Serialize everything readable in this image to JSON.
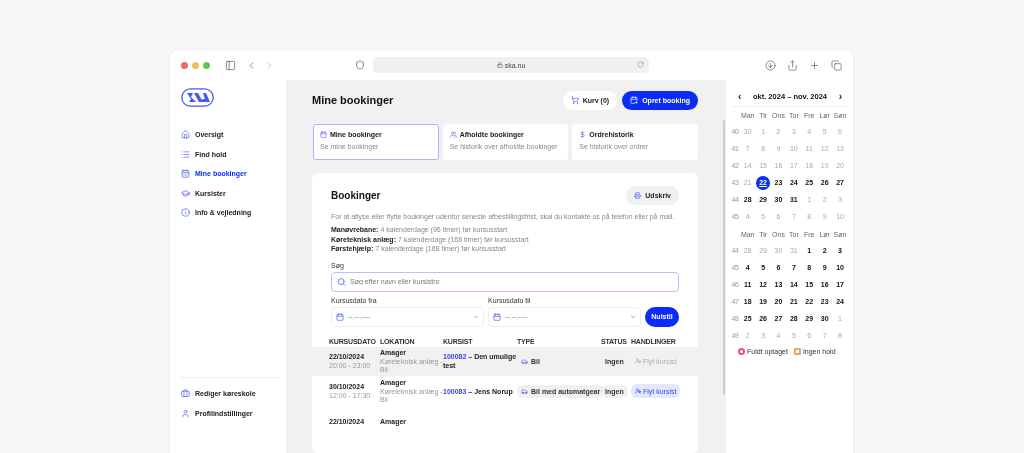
{
  "browser": {
    "address": "ska.nu"
  },
  "sidebar": {
    "items": [
      {
        "label": "Oversigt",
        "selected": false
      },
      {
        "label": "Find hold",
        "selected": false
      },
      {
        "label": "Mine bookinger",
        "selected": true
      },
      {
        "label": "Kursister",
        "selected": false
      },
      {
        "label": "Info & vejledning",
        "selected": false
      }
    ],
    "bottom_items": [
      {
        "label": "Rediger køreskole",
        "selected": false
      },
      {
        "label": "Profilindstillinger",
        "selected": false
      }
    ]
  },
  "page": {
    "title": "Mine bookinger",
    "cart_button": "Kurv (0)",
    "create_button": "Opret booking"
  },
  "tabs": [
    {
      "title": "Mine bookinger",
      "subtitle": "Se mine bookinger",
      "selected": true
    },
    {
      "title": "Afholdte bookinger",
      "subtitle": "Se historik over afholdte bookinger",
      "selected": false
    },
    {
      "title": "Ordrehistorik",
      "subtitle": "Se historik over ordrer",
      "selected": false
    }
  ],
  "bookings": {
    "title": "Bookinger",
    "print_button": "Udskriv",
    "notice": "For at aflyse eller flytte bookinger udenfor seneste afbestillingsfrist, skal du kontakte os på telefon eller på mail.",
    "deadlines": [
      "**Manøvrebane:** 4 kalenderdage (96 timer) før kursusstart",
      "**Køreteknisk anlæg:** 7 kalenderdage (168 timer) før kursusstart",
      "**Førstehjælp:** 7 kalenderdage (168 timer) før kursusstart"
    ],
    "search": {
      "label": "Søg",
      "placeholder": "Søg efter navn eller kursistnr."
    },
    "date_from": {
      "label": "Kursusdato fra",
      "placeholder": "--.--.----"
    },
    "date_to": {
      "label": "Kursusdato til",
      "placeholder": "--.--.----"
    },
    "reset_button": "Nulstil"
  },
  "table": {
    "columns": [
      "KURSUSDATO",
      "LOKATION",
      "KURSIST",
      "TYPE",
      "STATUS",
      "HANDLINGER"
    ],
    "rows": [
      {
        "date": "22/10/2024",
        "time": "20:00 - 23:00",
        "location": "Amager",
        "location_detail": "Køreteknisk anlæg - Bil",
        "student_id": "100082",
        "student_name": "– Den umulige test",
        "type": "Bil",
        "status": "Ingen",
        "action": {
          "label": "Flyt kursist",
          "disabled": true
        },
        "highlighted": true
      },
      {
        "date": "30/10/2024",
        "time": "12:00 - 17:30",
        "location": "Amager",
        "location_detail": "Køreteknisk anlæg - Bil",
        "student_id": "100083",
        "student_name": "– Jens Norup",
        "type": "Bil med automatgear",
        "status": "Ingen",
        "action": {
          "label": "Flyt kursist",
          "disabled": false
        },
        "highlighted": false
      },
      {
        "date": "22/10/2024",
        "location": "Amager",
        "highlighted": false
      }
    ]
  },
  "calendar": {
    "title": "okt. 2024 – nov. 2024",
    "prev": "‹",
    "next": "›",
    "months": [
      {
        "weekdays": [
          "Man",
          "Tir",
          "Ons",
          "Tor",
          "Fre",
          "Lør",
          "Søn"
        ],
        "weeks": [
          {
            "number": "40",
            "days": [
              {
                "label": "30",
                "muted": true,
                "selected": false
              },
              {
                "label": "1",
                "muted": true,
                "selected": false
              },
              {
                "label": "2",
                "muted": true,
                "selected": false
              },
              {
                "label": "3",
                "muted": true,
                "selected": false
              },
              {
                "label": "4",
                "muted": true,
                "selected": false
              },
              {
                "label": "5",
                "muted": true,
                "selected": false
              },
              {
                "label": "6",
                "muted": true,
                "selected": false
              }
            ]
          },
          {
            "number": "41",
            "days": [
              {
                "label": "7",
                "muted": true,
                "selected": false
              },
              {
                "label": "8",
                "muted": true,
                "selected": false
              },
              {
                "label": "9",
                "muted": true,
                "selected": false
              },
              {
                "label": "10",
                "muted": true,
                "selected": false
              },
              {
                "label": "11",
                "muted": true,
                "selected": false
              },
              {
                "label": "12",
                "muted": true,
                "selected": false
              },
              {
                "label": "13",
                "muted": true,
                "selected": false
              }
            ]
          },
          {
            "number": "42",
            "days": [
              {
                "label": "14",
                "muted": true,
                "selected": false
              },
              {
                "label": "15",
                "muted": true,
                "selected": false
              },
              {
                "label": "16",
                "muted": true,
                "selected": false
              },
              {
                "label": "17",
                "muted": true,
                "selected": false
              },
              {
                "label": "18",
                "muted": true,
                "selected": false
              },
              {
                "label": "19",
                "muted": true,
                "selected": false
              },
              {
                "label": "20",
                "muted": true,
                "selected": false
              }
            ]
          },
          {
            "number": "43",
            "days": [
              {
                "label": "21",
                "muted": true,
                "selected": false
              },
              {
                "label": "22",
                "muted": false,
                "selected": true
              },
              {
                "label": "23",
                "muted": false,
                "selected": false
              },
              {
                "label": "24",
                "muted": false,
                "selected": false
              },
              {
                "label": "25",
                "muted": false,
                "selected": false
              },
              {
                "label": "26",
                "muted": false,
                "selected": false
              },
              {
                "label": "27",
                "muted": false,
                "selected": false
              }
            ]
          },
          {
            "number": "44",
            "days": [
              {
                "label": "28",
                "muted": false,
                "selected": false
              },
              {
                "label": "29",
                "muted": false,
                "selected": false
              },
              {
                "label": "30",
                "muted": false,
                "selected": false
              },
              {
                "label": "31",
                "muted": false,
                "selected": false
              },
              {
                "label": "1",
                "muted": true,
                "selected": false
              },
              {
                "label": "2",
                "muted": true,
                "selected": false
              },
              {
                "label": "3",
                "muted": true,
                "selected": false
              }
            ]
          },
          {
            "number": "45",
            "days": [
              {
                "label": "4",
                "muted": true,
                "selected": false
              },
              {
                "label": "5",
                "muted": true,
                "selected": false
              },
              {
                "label": "6",
                "muted": true,
                "selected": false
              },
              {
                "label": "7",
                "muted": true,
                "selected": false
              },
              {
                "label": "8",
                "muted": true,
                "selected": false
              },
              {
                "label": "9",
                "muted": true,
                "selected": false
              },
              {
                "label": "10",
                "muted": true,
                "selected": false
              }
            ]
          }
        ]
      },
      {
        "weekdays": [
          "Man",
          "Tir",
          "Ons",
          "Tor",
          "Fre",
          "Lør",
          "Søn"
        ],
        "weeks": [
          {
            "number": "44",
            "days": [
              {
                "label": "28",
                "muted": true,
                "selected": false
              },
              {
                "label": "29",
                "muted": true,
                "selected": false
              },
              {
                "label": "30",
                "muted": true,
                "selected": false
              },
              {
                "label": "31",
                "muted": true,
                "selected": false
              },
              {
                "label": "1",
                "muted": false,
                "selected": false
              },
              {
                "label": "2",
                "muted": false,
                "selected": false
              },
              {
                "label": "3",
                "muted": false,
                "selected": false
              }
            ]
          },
          {
            "number": "45",
            "days": [
              {
                "label": "4",
                "muted": false,
                "selected": false
              },
              {
                "label": "5",
                "muted": false,
                "selected": false
              },
              {
                "label": "6",
                "muted": false,
                "selected": false
              },
              {
                "label": "7",
                "muted": false,
                "selected": false
              },
              {
                "label": "8",
                "muted": false,
                "selected": false
              },
              {
                "label": "9",
                "muted": false,
                "selected": false
              },
              {
                "label": "10",
                "muted": false,
                "selected": false
              }
            ]
          },
          {
            "number": "46",
            "days": [
              {
                "label": "11",
                "muted": false,
                "selected": false
              },
              {
                "label": "12",
                "muted": false,
                "selected": false
              },
              {
                "label": "13",
                "muted": false,
                "selected": false
              },
              {
                "label": "14",
                "muted": false,
                "selected": false
              },
              {
                "label": "15",
                "muted": false,
                "selected": false
              },
              {
                "label": "16",
                "muted": false,
                "selected": false
              },
              {
                "label": "17",
                "muted": false,
                "selected": false
              }
            ]
          },
          {
            "number": "47",
            "days": [
              {
                "label": "18",
                "muted": false,
                "selected": false
              },
              {
                "label": "19",
                "muted": false,
                "selected": false
              },
              {
                "label": "20",
                "muted": false,
                "selected": false
              },
              {
                "label": "21",
                "muted": false,
                "selected": false
              },
              {
                "label": "22",
                "muted": false,
                "selected": false
              },
              {
                "label": "23",
                "muted": false,
                "selected": false
              },
              {
                "label": "24",
                "muted": false,
                "selected": false
              }
            ]
          },
          {
            "number": "48",
            "days": [
              {
                "label": "25",
                "muted": false,
                "selected": false
              },
              {
                "label": "26",
                "muted": false,
                "selected": false
              },
              {
                "label": "27",
                "muted": false,
                "selected": false
              },
              {
                "label": "28",
                "muted": false,
                "selected": false
              },
              {
                "label": "29",
                "muted": false,
                "selected": false
              },
              {
                "label": "30",
                "muted": false,
                "selected": false
              },
              {
                "label": "1",
                "muted": true,
                "selected": false
              }
            ]
          },
          {
            "number": "49",
            "days": [
              {
                "label": "2",
                "muted": true,
                "selected": false
              },
              {
                "label": "3",
                "muted": true,
                "selected": false
              },
              {
                "label": "4",
                "muted": true,
                "selected": false
              },
              {
                "label": "5",
                "muted": true,
                "selected": false
              },
              {
                "label": "6",
                "muted": true,
                "selected": false
              },
              {
                "label": "7",
                "muted": true,
                "selected": false
              },
              {
                "label": "8",
                "muted": true,
                "selected": false
              }
            ]
          }
        ]
      }
    ],
    "legend": [
      {
        "label": "Fuldt optaget",
        "kind": "circle",
        "color": "#f0506e"
      },
      {
        "label": "Ingen hold",
        "kind": "square",
        "color": "#f5a35a"
      }
    ]
  }
}
